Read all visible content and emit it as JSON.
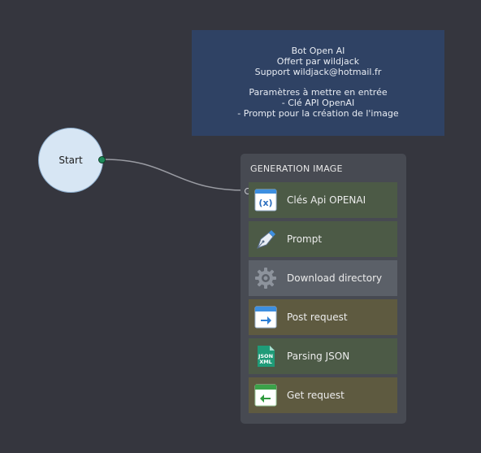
{
  "note": {
    "lines": [
      "Bot Open AI",
      "Offert par wildjack",
      "Support wildjack@hotmail.fr",
      "",
      "Paramètres à mettre en entrée",
      "- Clé API OpenAI",
      "- Prompt pour la création de l'image"
    ]
  },
  "start_node": {
    "label": "Start"
  },
  "group": {
    "title": "GENERATION IMAGE",
    "steps": [
      {
        "label": "Clés Api OPENAI",
        "icon": "variable-icon",
        "color": "#4c5a46"
      },
      {
        "label": "Prompt",
        "icon": "pen-icon",
        "color": "#4c5a46"
      },
      {
        "label": "Download directory",
        "icon": "gear-icon",
        "color": "#5b6068"
      },
      {
        "label": "Post request",
        "icon": "post-request-icon",
        "color": "#5e5a40"
      },
      {
        "label": "Parsing JSON",
        "icon": "json-xml-icon",
        "color": "#4c5a46"
      },
      {
        "label": "Get request",
        "icon": "get-request-icon",
        "color": "#5e5a40"
      }
    ]
  },
  "colors": {
    "canvas": "#35363e",
    "note": "#2f4264",
    "start_fill": "#d7e6f4",
    "connector": "#9a9ca3"
  }
}
